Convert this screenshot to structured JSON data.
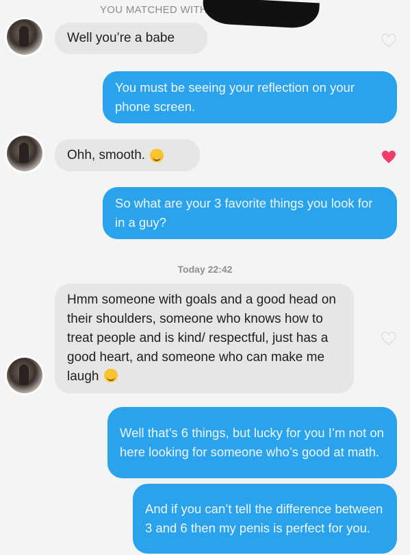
{
  "header": {
    "matched_text": "YOU MATCHED WITH"
  },
  "timestamp": "Today 22:42",
  "messages": [
    {
      "side": "in",
      "text": "Well you’re a babe",
      "liked": false
    },
    {
      "side": "out",
      "text": "You must be seeing your reflection on your phone screen."
    },
    {
      "side": "in",
      "text": "Ohh, smooth.",
      "emoji": "winking-tongue-emoji",
      "liked": true
    },
    {
      "side": "out",
      "text": "So what are your 3 favorite things you look for in a guy?"
    },
    {
      "side": "in",
      "text": "Hmm someone with goals and a good head on their shoulders, someone who knows how to treat people and is kind/ respectful, just has a good heart, and someone who can make me laugh",
      "emoji": "smiling-emoji",
      "liked": false
    },
    {
      "side": "out",
      "text": "Well that’s 6 things, but lucky for you I’m not on here looking for someone who’s good at math."
    },
    {
      "side": "out",
      "text": "And if you can’t tell the difference between 3 and 6 then my penis is perfect for you."
    }
  ],
  "colors": {
    "outgoing": "#2ba3ec",
    "incoming": "#e6e6e6",
    "heart_liked": "#ee3f6a",
    "heart_empty": "#e2e2e2"
  }
}
